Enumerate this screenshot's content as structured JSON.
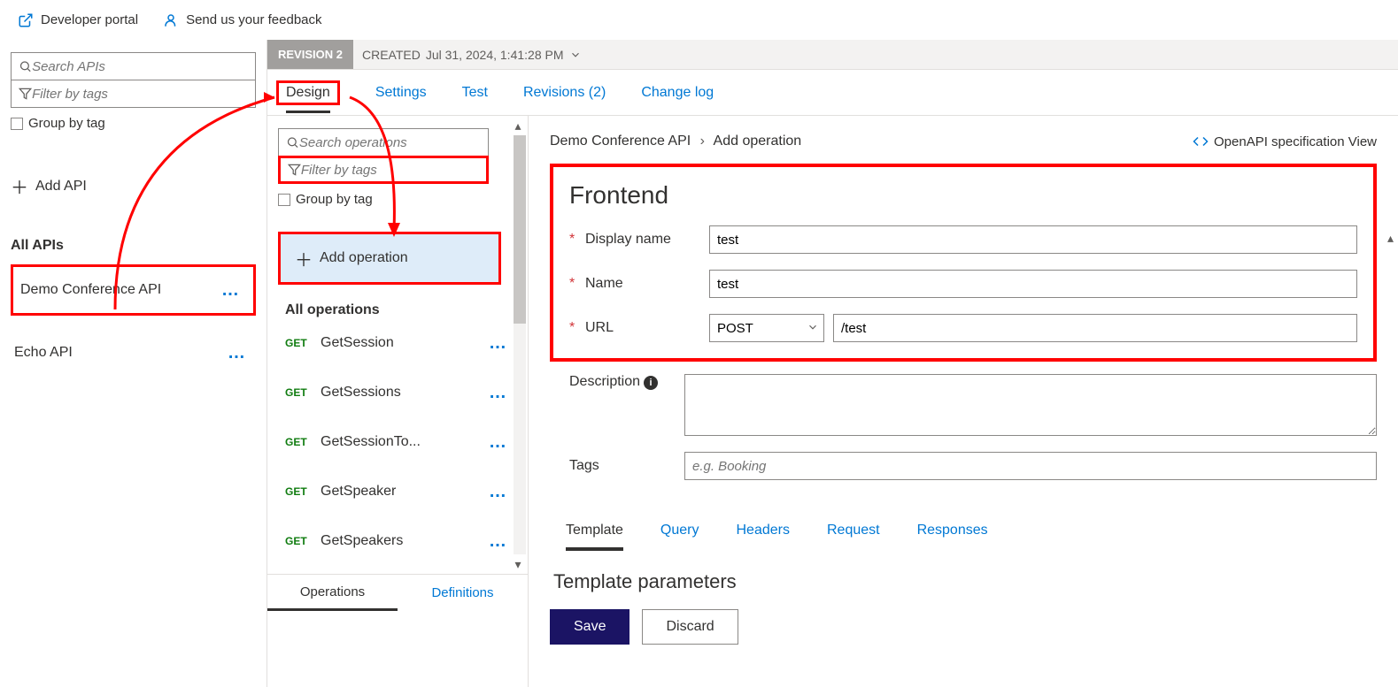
{
  "topbar": {
    "dev_portal": "Developer portal",
    "feedback": "Send us your feedback"
  },
  "left": {
    "search_placeholder": "Search APIs",
    "filter_placeholder": "Filter by tags",
    "group_by_tag": "Group by tag",
    "add_api": "Add API",
    "all_apis": "All APIs",
    "apis": [
      {
        "name": "Demo Conference API"
      },
      {
        "name": "Echo API"
      }
    ]
  },
  "revision": {
    "badge": "REVISION 2",
    "created_label": "CREATED",
    "created_value": "Jul 31, 2024, 1:41:28 PM"
  },
  "tabs": {
    "design": "Design",
    "settings": "Settings",
    "test": "Test",
    "revisions": "Revisions (2)",
    "changelog": "Change log"
  },
  "mid": {
    "search_placeholder": "Search operations",
    "filter_placeholder": "Filter by tags",
    "group_by_tag": "Group by tag",
    "add_operation": "Add operation",
    "all_operations": "All operations",
    "operations": [
      {
        "method": "GET",
        "name": "GetSession"
      },
      {
        "method": "GET",
        "name": "GetSessions"
      },
      {
        "method": "GET",
        "name": "GetSessionTo..."
      },
      {
        "method": "GET",
        "name": "GetSpeaker"
      },
      {
        "method": "GET",
        "name": "GetSpeakers"
      }
    ],
    "bottom": {
      "operations": "Operations",
      "definitions": "Definitions"
    }
  },
  "right": {
    "crumb_api": "Demo Conference API",
    "crumb_action": "Add operation",
    "openapi": "OpenAPI specification View",
    "frontend": "Frontend",
    "labels": {
      "display_name": "Display name",
      "name": "Name",
      "url": "URL",
      "description": "Description",
      "tags": "Tags"
    },
    "values": {
      "display_name": "test",
      "name": "test",
      "method": "POST",
      "url_path": "/test",
      "tags_placeholder": "e.g. Booking"
    },
    "subtabs": {
      "template": "Template",
      "query": "Query",
      "headers": "Headers",
      "request": "Request",
      "responses": "Responses"
    },
    "template_params": "Template parameters",
    "buttons": {
      "save": "Save",
      "discard": "Discard"
    }
  }
}
